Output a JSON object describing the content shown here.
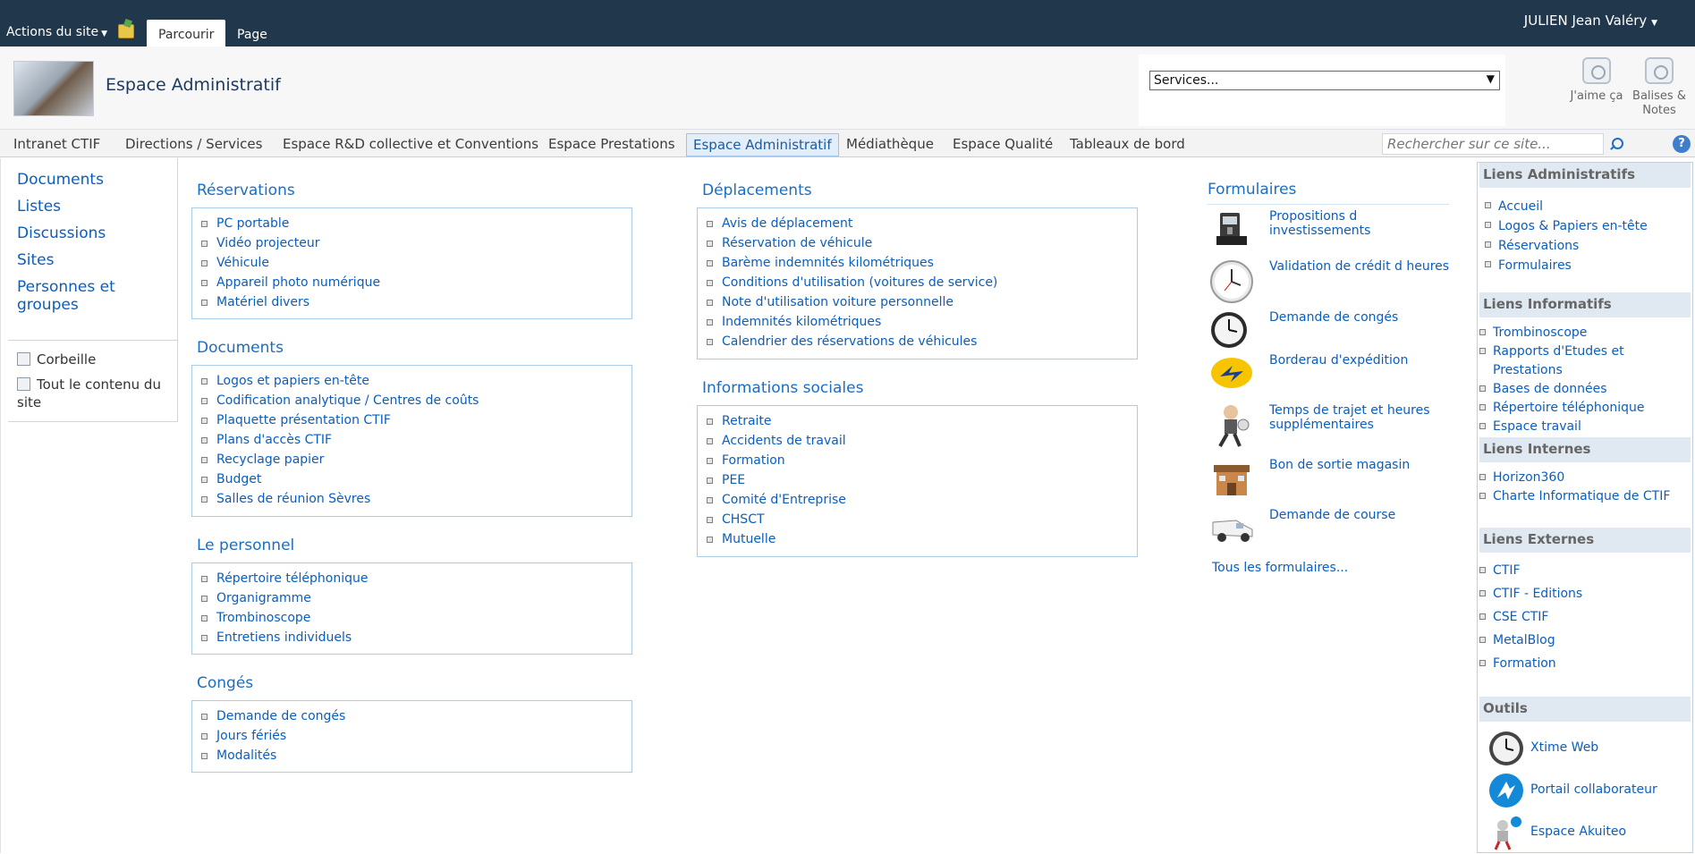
{
  "ribbon": {
    "site_actions": "Actions du site",
    "tabs": [
      "Parcourir",
      "Page"
    ],
    "user": "JULIEN Jean Valéry"
  },
  "header": {
    "site_title": "Espace Administratif",
    "services_select": "Services...",
    "like_label": "J'aime ça",
    "tags_label_1": "Balises &",
    "tags_label_2": "Notes"
  },
  "topnav": {
    "items": [
      "Intranet CTIF",
      "Directions / Services",
      "Espace R&D collective et Conventions",
      "Espace Prestations",
      "Espace Administratif",
      "Médiathèque",
      "Espace Qualité",
      "Tableaux de bord"
    ],
    "search_placeholder": "Rechercher sur ce site...",
    "help": "?"
  },
  "quicklaunch": {
    "links": [
      "Documents",
      "Listes",
      "Discussions",
      "Sites",
      "Personnes et",
      "groupes"
    ],
    "recycle": "Corbeille",
    "all_content_1": "Tout le contenu du",
    "all_content_2": "site"
  },
  "sections": {
    "reservations": {
      "title": "Réservations",
      "items": [
        "PC portable",
        "Vidéo projecteur",
        "Véhicule",
        "Appareil photo numérique",
        "Matériel divers"
      ]
    },
    "documents": {
      "title": "Documents",
      "items": [
        "Logos et papiers en-tête",
        "Codification analytique / Centres de coûts",
        "Plaquette présentation CTIF",
        "Plans d'accès CTIF",
        "Recyclage papier",
        "Budget",
        "Salles de réunion Sèvres"
      ]
    },
    "personnel": {
      "title": "Le personnel",
      "items": [
        "Répertoire téléphonique",
        "Organigramme",
        "Trombinoscope",
        "Entretiens individuels"
      ]
    },
    "conges": {
      "title": "Congés",
      "items": [
        "Demande de congés",
        "Jours fériés",
        "Modalités"
      ]
    },
    "deplacements": {
      "title": "Déplacements",
      "items": [
        "Avis de déplacement",
        "Réservation de véhicule",
        "Barème indemnités kilométriques",
        "Conditions d'utilisation (voitures de service)",
        "Note d'utilisation voiture personnelle",
        "Indemnités kilométriques",
        "Calendrier des réservations de véhicules"
      ]
    },
    "sociales": {
      "title": "Informations sociales",
      "items": [
        "Retraite",
        "Accidents de travail",
        "Formation",
        "PEE",
        "Comité d'Entreprise",
        "CHSCT",
        "Mutuelle"
      ]
    }
  },
  "formulaires": {
    "title": "Formulaires",
    "items": [
      {
        "label": "Propositions d investissements",
        "icon": "machine-icon"
      },
      {
        "label": "Validation de crédit d heures",
        "icon": "wall-clock-icon"
      },
      {
        "label": "Demande de congés",
        "icon": "clock-icon"
      },
      {
        "label": "Borderau d'expédition",
        "icon": "la-poste-icon"
      },
      {
        "label": "Temps de trajet et heures supplémentaires",
        "icon": "runner-icon"
      },
      {
        "label": "Bon de sortie magasin",
        "icon": "store-icon"
      },
      {
        "label": "Demande de course",
        "icon": "van-icon"
      }
    ],
    "all": "Tous les formulaires..."
  },
  "rightpanel": {
    "admin": {
      "title": "Liens Administratifs",
      "items": [
        "Accueil",
        "Logos & Papiers en-tête",
        "Réservations",
        "Formulaires"
      ]
    },
    "info": {
      "title": "Liens Informatifs",
      "items": [
        "Trombinoscope",
        "Rapports d'Etudes et Prestations",
        "Bases de données",
        "Répertoire téléphonique",
        "Espace travail"
      ]
    },
    "internes": {
      "title": "Liens Internes",
      "items": [
        "Horizon360",
        "Charte Informatique de CTIF"
      ]
    },
    "externes": {
      "title": "Liens Externes",
      "items": [
        "CTIF",
        "CTIF - Editions",
        "CSE CTIF",
        "MetalBlog",
        "Formation"
      ]
    },
    "outils": {
      "title": "Outils",
      "items": [
        "Xtime Web",
        "Portail collaborateur",
        "Espace Akuiteo"
      ]
    }
  },
  "colors": {
    "ribbon": "#21374c",
    "link": "#0a5ebd",
    "section_title": "#1b6ec2",
    "box_border": "#a8cdea"
  }
}
